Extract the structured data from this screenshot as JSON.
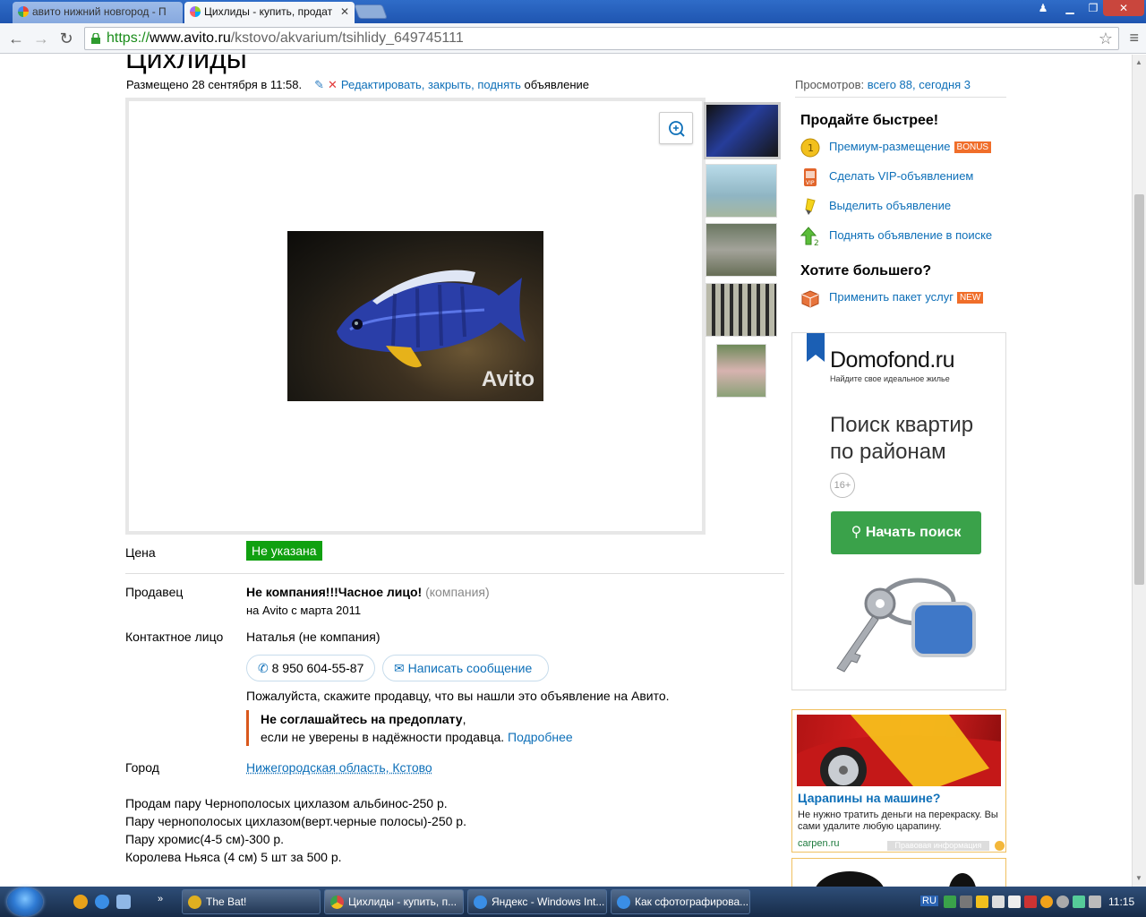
{
  "browser": {
    "tabs": [
      {
        "title": "авито нижний новгород - П",
        "active": false
      },
      {
        "title": "Цихлиды - купить, продат",
        "active": true
      }
    ],
    "url": {
      "scheme": "https://",
      "host": "www.avito.ru",
      "path": "/kstovo/akvarium/tsihlidy_649745111"
    }
  },
  "ad": {
    "title": "Цихлиды",
    "posted": "Размещено 28 сентября в 11:58.",
    "edit_link": "Редактировать, закрыть, поднять",
    "edit_suffix": "объявление",
    "views_label": "Просмотров:",
    "views_value": "всего 88, сегодня 3",
    "watermark": "Avito"
  },
  "params": {
    "price_label": "Цена",
    "price_value": "Не указана",
    "seller_label": "Продавец",
    "seller_name": "Не компания!!!Часное лицо!",
    "seller_type": "(компания)",
    "seller_since": "на Avito с марта 2011",
    "contact_label": "Контактное лицо",
    "contact_value": "Наталья (не компания)",
    "phone": "8 950 604-55-87",
    "message_button": "Написать сообщение",
    "please_note": "Пожалуйста, скажите продавцу, что вы нашли это объявление на Авито.",
    "warning_bold": "Не соглашайтесь на предоплату",
    "warning_comma": ",",
    "warning_text": "если не уверены в надёжности продавца.",
    "warning_link": "Подробнее",
    "city_label": "Город",
    "city_value": "Нижегородская область, Кстово"
  },
  "description": [
    "Продам пару Чернополосых цихлазом альбинос-250 р.",
    "Пару чернополосых цихлазом(верт.черные полосы)-250 р.",
    "Пару хромис(4-5 см)-300 р.",
    "Королева Ньяса (4 см) 5 шт за 500 р."
  ],
  "sidebar": {
    "sell_faster": "Продайте быстрее!",
    "items": [
      {
        "label": "Премиум-размещение",
        "tag": "BONUS",
        "icon": "coin-icon"
      },
      {
        "label": "Сделать VIP-объявлением",
        "tag": "",
        "icon": "vip-icon"
      },
      {
        "label": "Выделить объявление",
        "tag": "",
        "icon": "highlighter-icon"
      },
      {
        "label": "Поднять объявление в поиске",
        "tag": "",
        "icon": "raise-icon"
      }
    ],
    "want_more": "Хотите большего?",
    "package": {
      "label": "Применить пакет услуг",
      "tag": "NEW",
      "icon": "package-icon"
    }
  },
  "domofond": {
    "brand": "Domofond.ru",
    "tagline": "Найдите свое идеальное жилье",
    "headline": "Поиск квартир по районам",
    "age": "16+",
    "button": "Начать поиск"
  },
  "carpen": {
    "title": "Царапины на машине?",
    "text": "Не нужно тратить деньги на перекраску. Вы сами удалите любую царапину.",
    "domain": "carpen.ru",
    "legal": "Правовая информация",
    "banner_text": "ЦАРАПИНЫ НА МАШИНЕ?"
  },
  "taskbar": {
    "items": [
      {
        "label": "The Bat!",
        "color": "#e0b020"
      },
      {
        "label": "Цихлиды - купить, п...",
        "color": "#d44"
      },
      {
        "label": "Яндекс - Windows Int...",
        "color": "#3a8ee6"
      },
      {
        "label": "Как сфотографирова...",
        "color": "#3a8ee6"
      }
    ],
    "lang": "RU",
    "time": "11:15"
  }
}
